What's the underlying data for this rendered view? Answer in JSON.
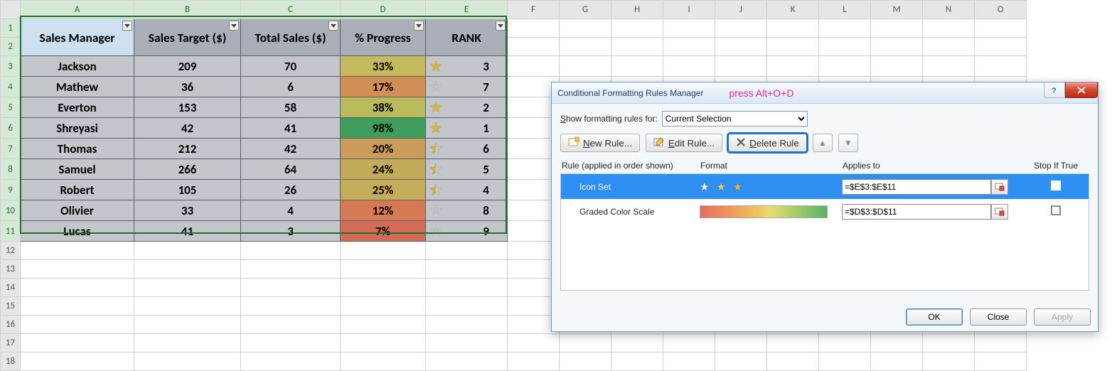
{
  "columns": [
    "A",
    "B",
    "C",
    "D",
    "E",
    "F",
    "G",
    "H",
    "I",
    "J",
    "K",
    "L",
    "M",
    "N",
    "O"
  ],
  "row_headers": [
    1,
    2,
    3,
    4,
    5,
    6,
    7,
    8,
    9,
    10,
    11,
    12,
    13,
    14,
    15,
    16,
    17,
    18
  ],
  "table": {
    "headers": [
      "Sales Manager",
      "Sales Target ($)",
      "Total Sales ($)",
      "% Progress",
      "RANK"
    ],
    "rows": [
      {
        "mgr": "Jackson",
        "target": 209,
        "sales": 70,
        "prog": "33%",
        "rank": 3,
        "star": "full",
        "bg": "#c6ba5e"
      },
      {
        "mgr": "Mathew",
        "target": 36,
        "sales": 6,
        "prog": "17%",
        "rank": 7,
        "star": "empty",
        "bg": "#d28f55"
      },
      {
        "mgr": "Everton",
        "target": 153,
        "sales": 58,
        "prog": "38%",
        "rank": 2,
        "star": "full",
        "bg": "#b9ba5c"
      },
      {
        "mgr": "Shreyasi",
        "target": 42,
        "sales": 41,
        "prog": "98%",
        "rank": 1,
        "star": "full",
        "bg": "#3f9e5c"
      },
      {
        "mgr": "Thomas",
        "target": 212,
        "sales": 42,
        "prog": "20%",
        "rank": 6,
        "star": "half",
        "bg": "#cb9c59"
      },
      {
        "mgr": "Samuel",
        "target": 266,
        "sales": 64,
        "prog": "24%",
        "rank": 5,
        "star": "half",
        "bg": "#c4aa5b"
      },
      {
        "mgr": "Robert",
        "target": 105,
        "sales": 26,
        "prog": "25%",
        "rank": 4,
        "star": "half",
        "bg": "#c4ac5b"
      },
      {
        "mgr": "Olivier",
        "target": 33,
        "sales": 4,
        "prog": "12%",
        "rank": 8,
        "star": "empty",
        "bg": "#d57a53"
      },
      {
        "mgr": "Lucas",
        "target": 41,
        "sales": 3,
        "prog": "7%",
        "rank": 9,
        "star": "empty",
        "bg": "#d56c55"
      }
    ]
  },
  "dialog": {
    "title": "Conditional Formatting Rules Manager",
    "annot": "press Alt+O+D",
    "show_label": "Show formatting rules for:",
    "show_value": "Current Selection",
    "buttons": {
      "new": "New Rule...",
      "edit": "Edit Rule...",
      "del": "Delete Rule"
    },
    "headers": {
      "rule": "Rule (applied in order shown)",
      "format": "Format",
      "applies": "Applies to",
      "stop": "Stop If True"
    },
    "rules": [
      {
        "name": "Icon Set",
        "applies": "=$E$3:$E$11",
        "type": "iconset",
        "selected": true
      },
      {
        "name": "Graded Color Scale",
        "applies": "=$D$3:$D$11",
        "type": "gradient",
        "selected": false
      }
    ],
    "footer": {
      "ok": "OK",
      "close": "Close",
      "apply": "Apply"
    }
  }
}
